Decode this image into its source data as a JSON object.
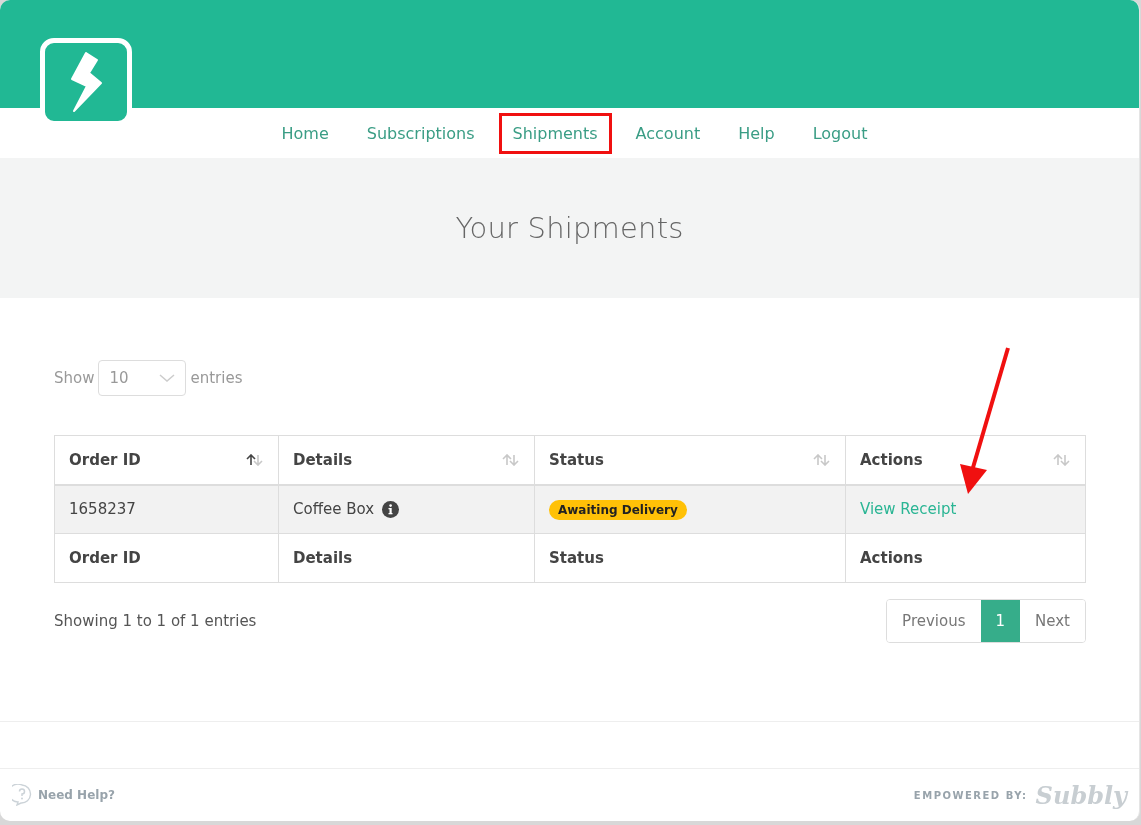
{
  "nav": [
    {
      "label": "Home",
      "selected": false
    },
    {
      "label": "Subscriptions",
      "selected": false
    },
    {
      "label": "Shipments",
      "selected": true
    },
    {
      "label": "Account",
      "selected": false
    },
    {
      "label": "Help",
      "selected": false
    },
    {
      "label": "Logout",
      "selected": false
    }
  ],
  "page_title": "Your Shipments",
  "length_control": {
    "before": "Show",
    "value": "10",
    "after": "entries"
  },
  "table": {
    "columns": [
      {
        "label": "Order ID",
        "sorted_ascending": true
      },
      {
        "label": "Details",
        "sorted_ascending": false
      },
      {
        "label": "Status",
        "sorted_ascending": false
      },
      {
        "label": "Actions",
        "sorted_ascending": false
      }
    ],
    "rows": [
      {
        "order_id": "1658237",
        "details": "Coffee Box",
        "status": "Awaiting Delivery",
        "action": "View Receipt"
      }
    ],
    "footer": [
      "Order ID",
      "Details",
      "Status",
      "Actions"
    ]
  },
  "info": "Showing 1 to 1 of 1 entries",
  "pagination": [
    {
      "label": "Previous",
      "selected": false
    },
    {
      "label": "1",
      "selected": true
    },
    {
      "label": "Next",
      "selected": false
    }
  ],
  "footer": {
    "help": "Need Help?",
    "powered_by": "EMPOWERED BY:",
    "brand": "Subbly"
  }
}
